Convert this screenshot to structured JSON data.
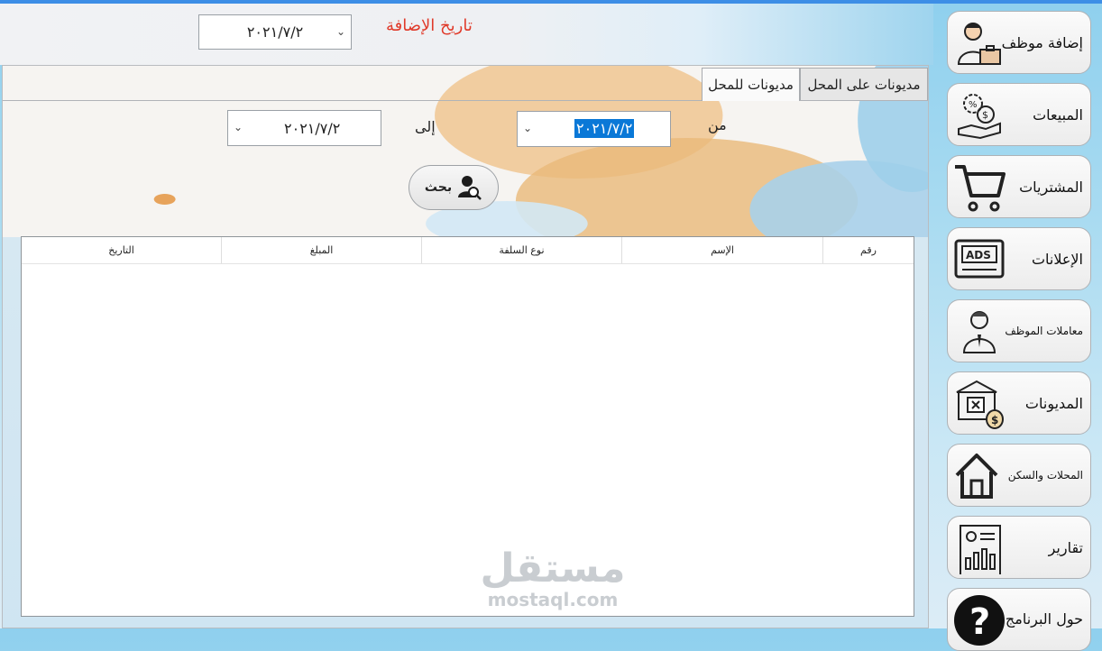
{
  "header": {
    "date_value": "٢٠٢١/٧/٢",
    "date_label": "تاريخ الإضافة"
  },
  "tabs": [
    {
      "label": "مديونات على المحل",
      "selected": false
    },
    {
      "label": "مديونات للمحل",
      "selected": true
    }
  ],
  "filters": {
    "from_label": "من",
    "from_value": "٢٠٢١/٧/٢",
    "to_label": "إلى",
    "to_value": "٢٠٢١/٧/٢"
  },
  "search_button": {
    "label": "بحث",
    "icon": "user-search-icon"
  },
  "table": {
    "columns": [
      "رقم",
      "الإسم",
      "نوع السلفة",
      "المبلغ",
      "التاريخ"
    ],
    "rows": []
  },
  "sidebar": {
    "items": [
      {
        "label": "إضافة موظف",
        "icon": "employee-briefcase-icon"
      },
      {
        "label": "المبيعات",
        "icon": "sales-hand-money-icon"
      },
      {
        "label": "المشتريات",
        "icon": "shopping-cart-icon"
      },
      {
        "label": "الإعلانات",
        "icon": "ads-screen-icon"
      },
      {
        "label": "معاملات الموظف",
        "icon": "employee-icon"
      },
      {
        "label": "المديونات",
        "icon": "bank-money-bag-icon"
      },
      {
        "label": "المحلات والسكن",
        "icon": "house-icon"
      },
      {
        "label": "تقارير",
        "icon": "report-chart-icon"
      },
      {
        "label": "حول البرنامج",
        "icon": "question-icon"
      }
    ]
  },
  "watermark": {
    "arabic": "مستقل",
    "latin": "mostaql.com"
  }
}
